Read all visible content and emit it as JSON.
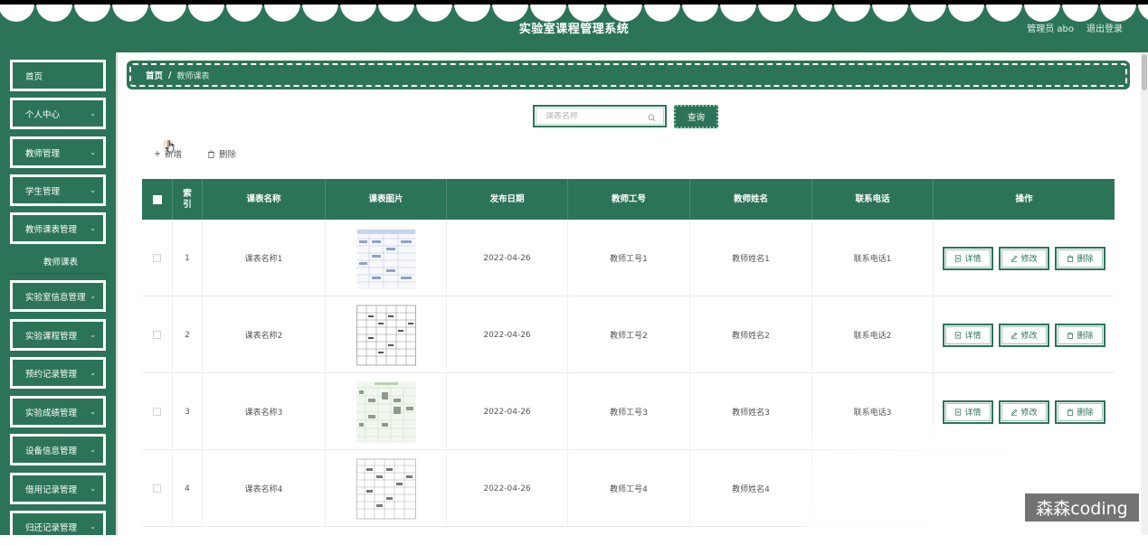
{
  "header": {
    "title": "实验室课程管理系统",
    "user_label": "管理员 abo",
    "logout_label": "退出登录"
  },
  "sidebar": {
    "items": [
      {
        "label": "首页"
      },
      {
        "label": "个人中心"
      },
      {
        "label": "教师管理"
      },
      {
        "label": "学生管理"
      },
      {
        "label": "教师课表管理"
      },
      {
        "label": "教师课表"
      },
      {
        "label": "实验室信息管理"
      },
      {
        "label": "实验课程管理"
      },
      {
        "label": "预约记录管理"
      },
      {
        "label": "实验成绩管理"
      },
      {
        "label": "设备信息管理"
      },
      {
        "label": "借用记录管理"
      },
      {
        "label": "归还记录管理"
      }
    ]
  },
  "breadcrumb": {
    "home": "首页",
    "separator": "/",
    "current": "教师课表"
  },
  "search": {
    "placeholder": "课表名称",
    "button_label": "查询"
  },
  "toolbar": {
    "add_label": "新增",
    "delete_label": "删除"
  },
  "table": {
    "columns": {
      "index": "索引",
      "name": "课表名称",
      "image": "课表图片",
      "date": "发布日期",
      "teacher_no": "教师工号",
      "teacher_name": "教师姓名",
      "phone": "联系电话",
      "actions": "操作"
    },
    "rows": [
      {
        "index": "1",
        "name": "课表名称1",
        "date": "2022-04-26",
        "teacher_no": "教师工号1",
        "teacher_name": "教师姓名1",
        "phone": "联系电话1"
      },
      {
        "index": "2",
        "name": "课表名称2",
        "date": "2022-04-26",
        "teacher_no": "教师工号2",
        "teacher_name": "教师姓名2",
        "phone": "联系电话2"
      },
      {
        "index": "3",
        "name": "课表名称3",
        "date": "2022-04-26",
        "teacher_no": "教师工号3",
        "teacher_name": "教师姓名3",
        "phone": "联系电话3"
      },
      {
        "index": "4",
        "name": "课表名称4",
        "date": "2022-04-26",
        "teacher_no": "教师工号4",
        "teacher_name": "教师姓名4",
        "phone": ""
      }
    ],
    "actions": {
      "detail": "详情",
      "edit": "修改",
      "delete": "删除"
    }
  },
  "watermark": "森森coding",
  "colors": {
    "primary": "#2c7458",
    "border_light": "#9cc3b0"
  }
}
